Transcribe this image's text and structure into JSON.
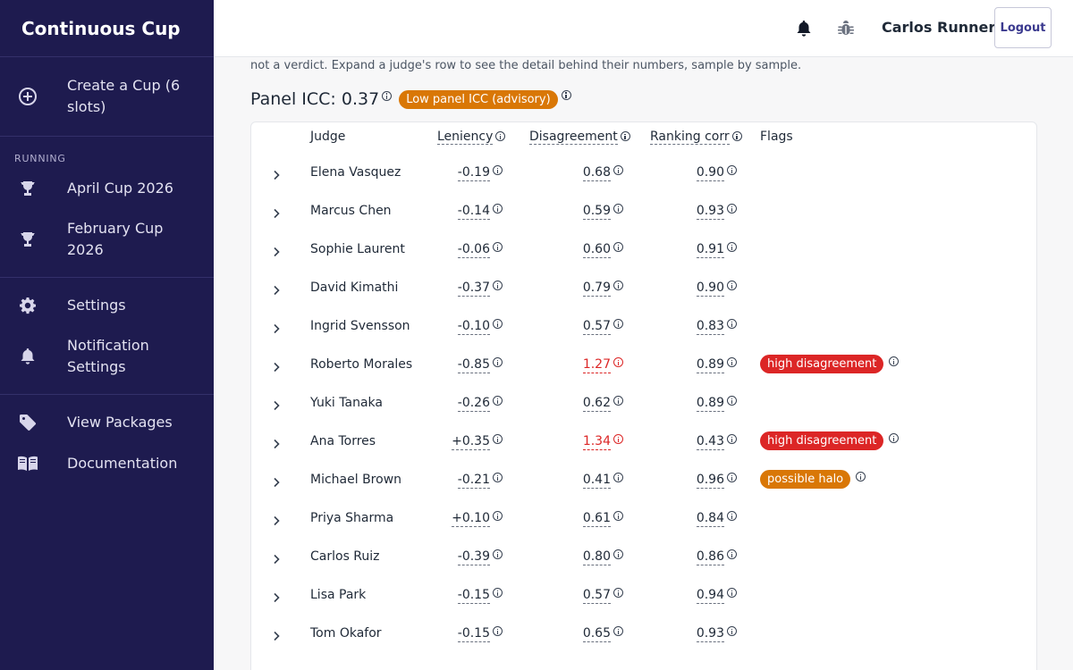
{
  "app": {
    "brand": "Continuous Cup"
  },
  "sidebar": {
    "create": "Create a Cup (6 slots)",
    "running_label": "RUNNING",
    "cups": [
      "April Cup 2026",
      "February Cup 2026"
    ],
    "settings": "Settings",
    "notification_settings": "Notification Settings",
    "view_packages": "View Packages",
    "documentation": "Documentation"
  },
  "topbar": {
    "user": "Carlos Runner",
    "logout": "Logout"
  },
  "intro_text": "not a verdict. Expand a judge's row to see the detail behind their numbers, sample by sample.",
  "panel": {
    "icc_label": "Panel ICC: 0.37",
    "advisory": "Low panel ICC (advisory)"
  },
  "table": {
    "headers": {
      "judge": "Judge",
      "leniency": "Leniency",
      "disagreement": "Disagreement",
      "ranking": "Ranking corr",
      "flags": "Flags"
    },
    "rows": [
      {
        "name": "Elena Vasquez",
        "leniency": "-0.19",
        "disagreement": "0.68",
        "ranking": "0.90",
        "flags": []
      },
      {
        "name": "Marcus Chen",
        "leniency": "-0.14",
        "disagreement": "0.59",
        "ranking": "0.93",
        "flags": []
      },
      {
        "name": "Sophie Laurent",
        "leniency": "-0.06",
        "disagreement": "0.60",
        "ranking": "0.91",
        "flags": []
      },
      {
        "name": "David Kimathi",
        "leniency": "-0.37",
        "disagreement": "0.79",
        "ranking": "0.90",
        "flags": []
      },
      {
        "name": "Ingrid Svensson",
        "leniency": "-0.10",
        "disagreement": "0.57",
        "ranking": "0.83",
        "flags": []
      },
      {
        "name": "Roberto Morales",
        "leniency": "-0.85",
        "disagreement": "1.27",
        "ranking": "0.89",
        "flags": [
          "high disagreement"
        ]
      },
      {
        "name": "Yuki Tanaka",
        "leniency": "-0.26",
        "disagreement": "0.62",
        "ranking": "0.89",
        "flags": []
      },
      {
        "name": "Ana Torres",
        "leniency": "+0.35",
        "disagreement": "1.34",
        "ranking": "0.43",
        "flags": [
          "high disagreement"
        ]
      },
      {
        "name": "Michael Brown",
        "leniency": "-0.21",
        "disagreement": "0.41",
        "ranking": "0.96",
        "flags": [
          "possible halo"
        ]
      },
      {
        "name": "Priya Sharma",
        "leniency": "+0.10",
        "disagreement": "0.61",
        "ranking": "0.84",
        "flags": []
      },
      {
        "name": "Carlos Ruiz",
        "leniency": "-0.39",
        "disagreement": "0.80",
        "ranking": "0.86",
        "flags": []
      },
      {
        "name": "Lisa Park",
        "leniency": "-0.15",
        "disagreement": "0.57",
        "ranking": "0.94",
        "flags": []
      },
      {
        "name": "Tom Okafor",
        "leniency": "-0.15",
        "disagreement": "0.65",
        "ranking": "0.93",
        "flags": []
      }
    ]
  },
  "colors": {
    "sidebar_bg": "#1e1b4f",
    "danger": "#dc2626",
    "warning": "#d97706"
  },
  "icons": [
    "plus-circle-icon",
    "trophy-icon",
    "gear-icon",
    "bell-icon",
    "tag-icon",
    "book-icon",
    "bug-icon",
    "chevron-right-icon",
    "info-icon"
  ]
}
